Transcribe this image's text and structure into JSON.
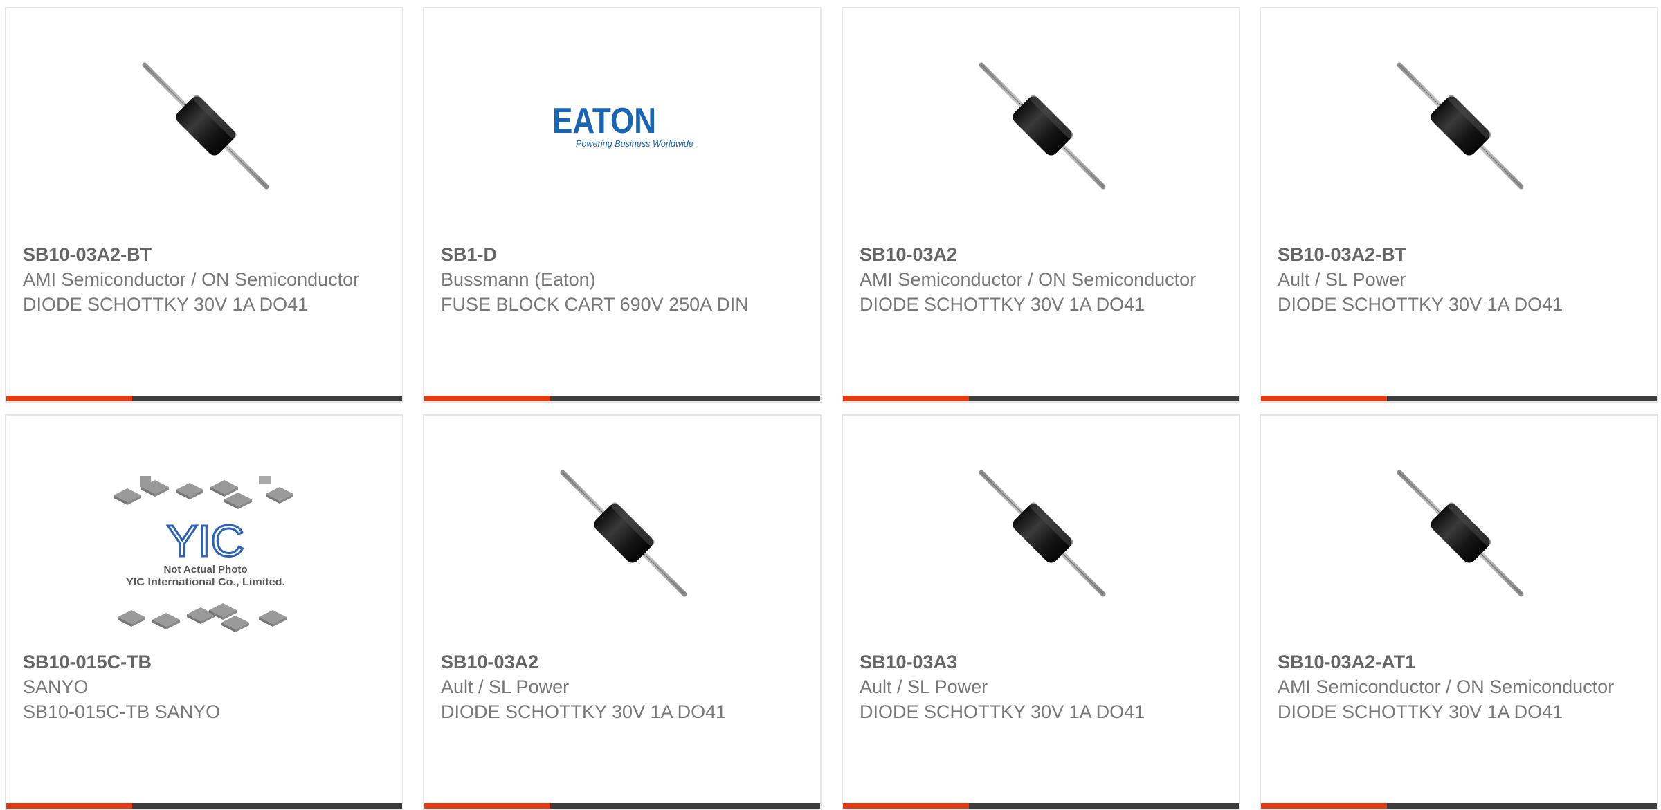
{
  "colors": {
    "accent": "#e03b12",
    "bar_dark": "#3d3d3d",
    "text": "#777777",
    "title": "#666666",
    "border": "#e6e6e6"
  },
  "cards": [
    {
      "part_number": "SB10-03A2-BT",
      "manufacturer": "AMI Semiconductor / ON Semiconductor",
      "description": "DIODE SCHOTTKY 30V 1A DO41",
      "image": "diode-axial"
    },
    {
      "part_number": "SB1-D",
      "manufacturer": "Bussmann (Eaton)",
      "description": "FUSE BLOCK CART 690V 250A DIN",
      "image": "eaton-logo",
      "logo_text": "EATON",
      "logo_tagline": "Powering Business Worldwide"
    },
    {
      "part_number": "SB10-03A2",
      "manufacturer": "AMI Semiconductor / ON Semiconductor",
      "description": "DIODE SCHOTTKY 30V 1A DO41",
      "image": "diode-axial"
    },
    {
      "part_number": "SB10-03A2-BT",
      "manufacturer": "Ault / SL Power",
      "description": "DIODE SCHOTTKY 30V 1A DO41",
      "image": "diode-axial"
    },
    {
      "part_number": "SB10-015C-TB",
      "manufacturer": "SANYO",
      "description": "SB10-015C-TB SANYO",
      "image": "yic-placeholder",
      "logo_text": "YIC",
      "photo_note": "Not Actual Photo",
      "photo_company": "YIC International Co., Limited."
    },
    {
      "part_number": "SB10-03A2",
      "manufacturer": "Ault / SL Power",
      "description": "DIODE SCHOTTKY 30V 1A DO41",
      "image": "diode-axial"
    },
    {
      "part_number": "SB10-03A3",
      "manufacturer": "Ault / SL Power",
      "description": "DIODE SCHOTTKY 30V 1A DO41",
      "image": "diode-axial"
    },
    {
      "part_number": "SB10-03A2-AT1",
      "manufacturer": "AMI Semiconductor / ON Semiconductor",
      "description": "DIODE SCHOTTKY 30V 1A DO41",
      "image": "diode-axial"
    }
  ]
}
